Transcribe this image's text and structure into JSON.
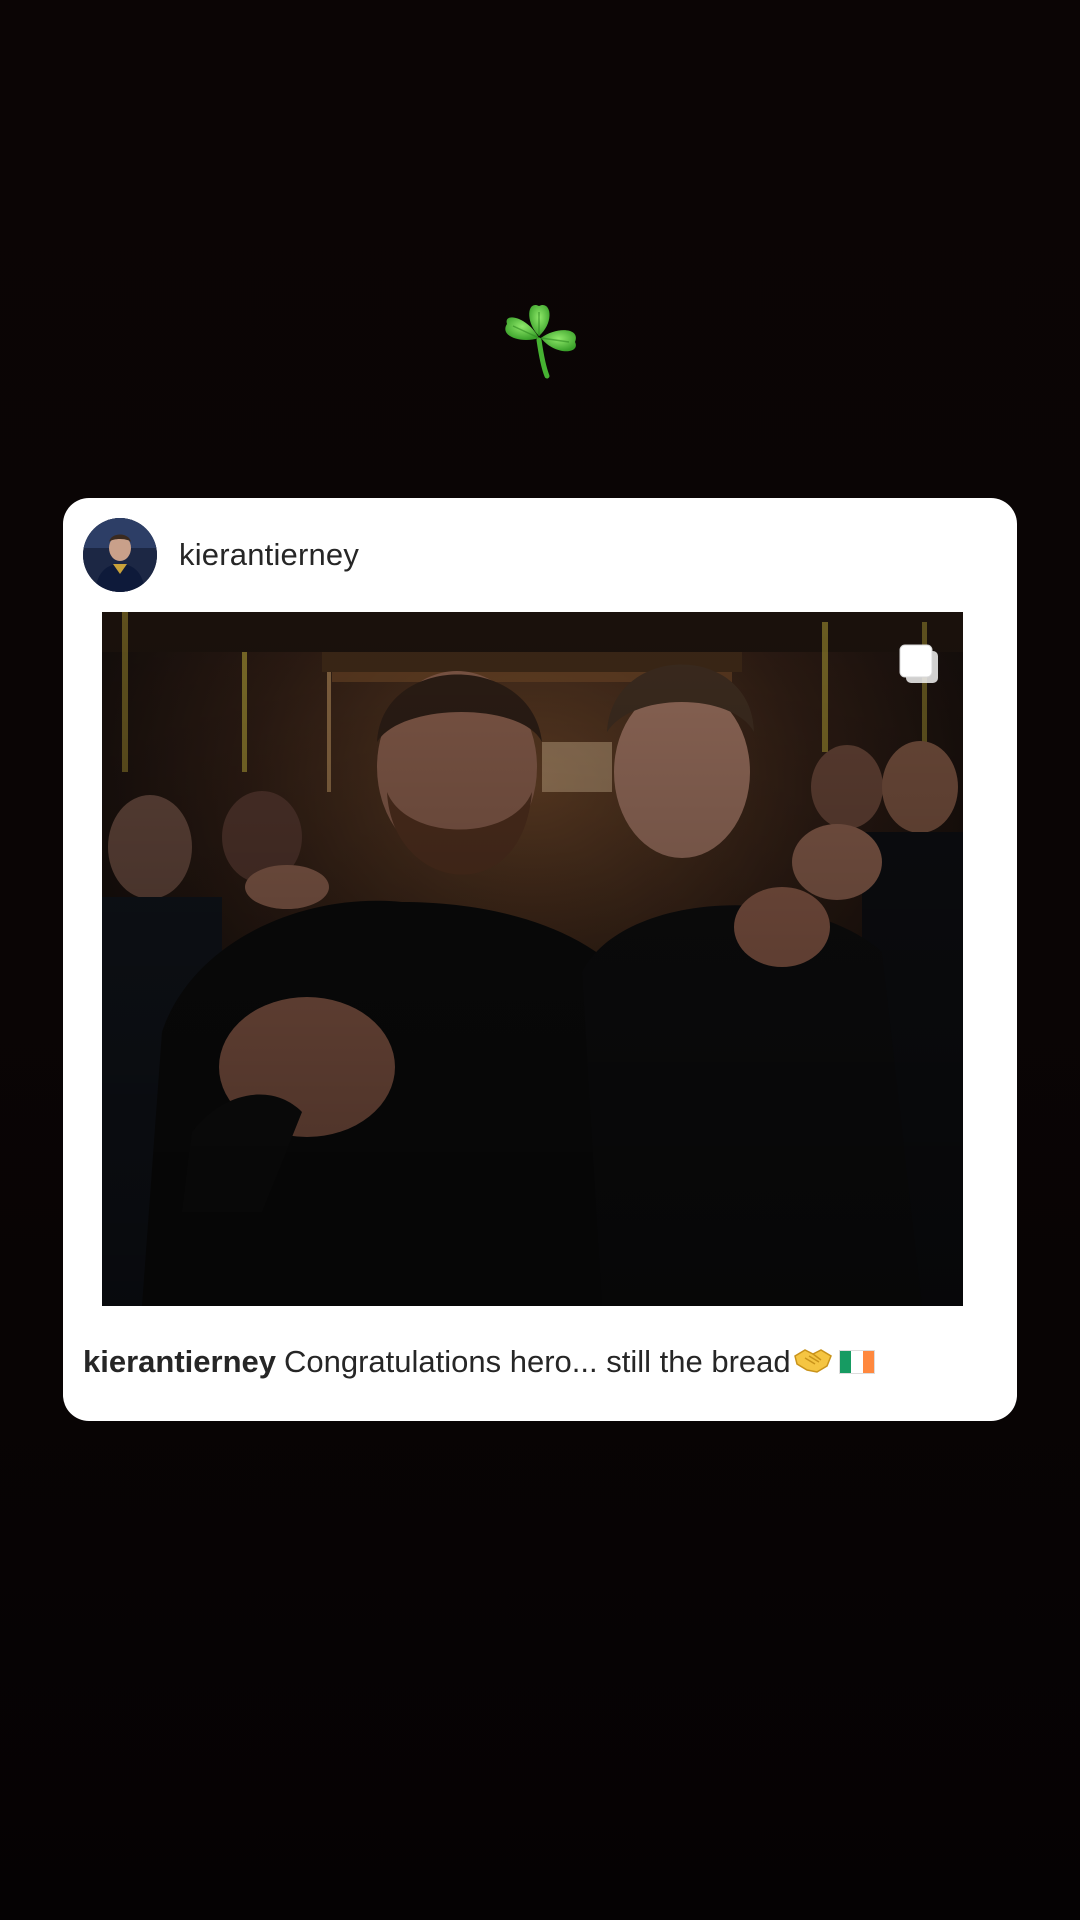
{
  "story": {
    "sticker_icon": "shamrock-icon",
    "background_color": "#0a0505"
  },
  "post": {
    "username": "kierantierney",
    "avatar_icon": "profile-avatar",
    "multi_image_icon": "carousel-icon",
    "caption": {
      "username": "kierantierney",
      "text": "Congratulations hero... still the bread",
      "emojis": [
        "handshake-icon",
        "ireland-flag-icon"
      ]
    }
  },
  "colors": {
    "card": "#ffffff",
    "text": "#262626",
    "shamrock": "#5ac93c"
  }
}
